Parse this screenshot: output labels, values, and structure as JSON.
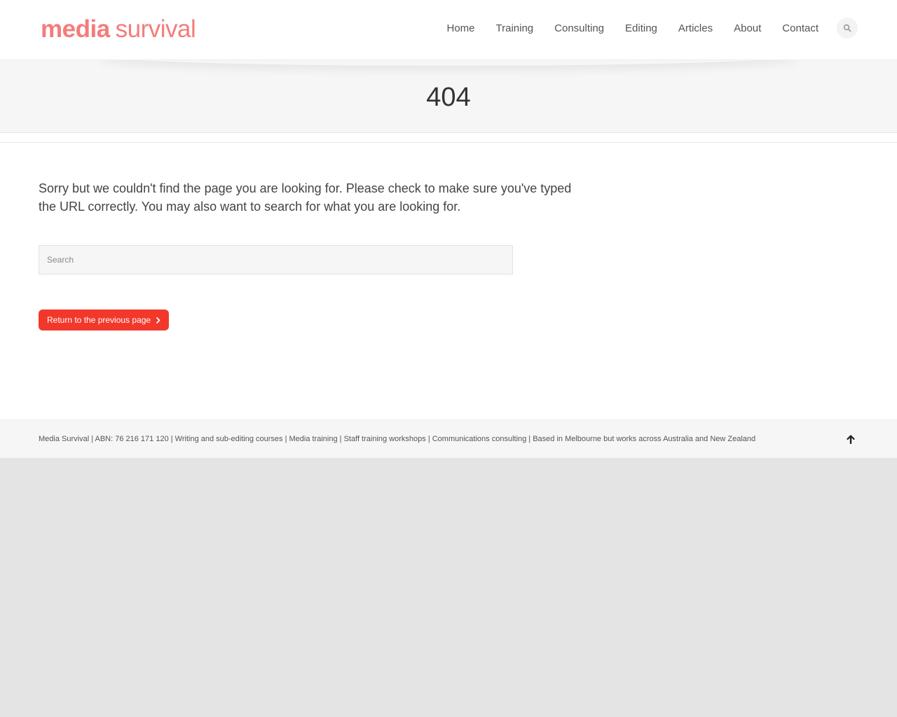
{
  "header": {
    "logo_bold": "media",
    "logo_light": "survival",
    "nav": [
      "Home",
      "Training",
      "Consulting",
      "Editing",
      "Articles",
      "About",
      "Contact"
    ]
  },
  "title_band": {
    "title": "404"
  },
  "content": {
    "message": "Sorry but we couldn't find the page you are looking for. Please check to make sure you've typed the URL correctly. You may also want to search for what you are looking for.",
    "search_placeholder": "Search",
    "return_label": "Return to the previous page"
  },
  "footer": {
    "text": "Media Survival | ABN: 76 216 171 120 | Writing and sub-editing courses | Media training | Staff training workshops | Communications consulting | Based in Melbourne but works across Australia and New Zealand"
  },
  "icons": {
    "search": "search-icon",
    "chevron": "chevron-right-icon",
    "to_top": "arrow-up-icon"
  },
  "colors": {
    "brand": "#f47c7c",
    "button": "#f2382b"
  }
}
